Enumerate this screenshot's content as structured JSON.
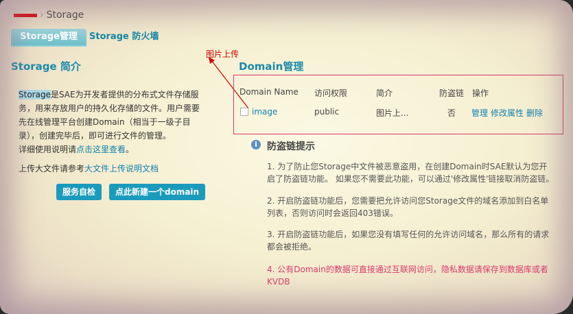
{
  "breadcrumb": {
    "current": "Storage"
  },
  "tabs": [
    {
      "label": "Storage管理"
    },
    {
      "label": "Storage 防火墙"
    }
  ],
  "left": {
    "title": "Storage 简介",
    "intro_highlight": "Storage",
    "intro_text": "是SAE为开发者提供的分布式文件存储服务，用来存放用户的持久化存储的文件。用户需要先在线管理平台创建Domain（相当于一级子目录），创建完毕后，即可进行文件的管理。",
    "help_prefix": "详细使用说明请",
    "help_link": "点击这里查看",
    "help_suffix": "。",
    "upload_prefix": "上传大文件请参考",
    "upload_link": "大文件上传说明文档",
    "buttons": {
      "self_check": "服务自检",
      "new_domain": "点此新建一个domain"
    }
  },
  "annotation": "图片上传",
  "domain": {
    "title": "Domain管理",
    "columns": [
      "Domain Name",
      "访问权限",
      "简介",
      "防盗链",
      "操作"
    ],
    "rows": [
      {
        "name": "image",
        "access": "public",
        "intro": "图片上...",
        "hotlink": "否",
        "ops": [
          "管理",
          "修改属性",
          "删除"
        ]
      }
    ]
  },
  "tips": {
    "title": "防盗链提示",
    "items": [
      "1. 为了防止您Storage中文件被恶意盗用，在创建Domain时SAE默认为您开启了防盗链功能。 如果您不需要此功能，可以通过'修改属性'链接取消防盗链。",
      "2. 开启防盗链功能后，您需要把允许访问您Storage文件的域名添加到白名单列表，否则访问时会返回403错误。",
      "3. 开启防盗链功能后，如果您没有填写任何的允许访问域名，那么所有的请求都会被拒绝。",
      "4. 公有Domain的数据可直接通过互联网访问，隐私数据请保存到数据库或者KVDB"
    ]
  },
  "colors": {
    "accent": "#1a8aab",
    "annotation": "#cc0000",
    "warning": "#d83a6c"
  }
}
